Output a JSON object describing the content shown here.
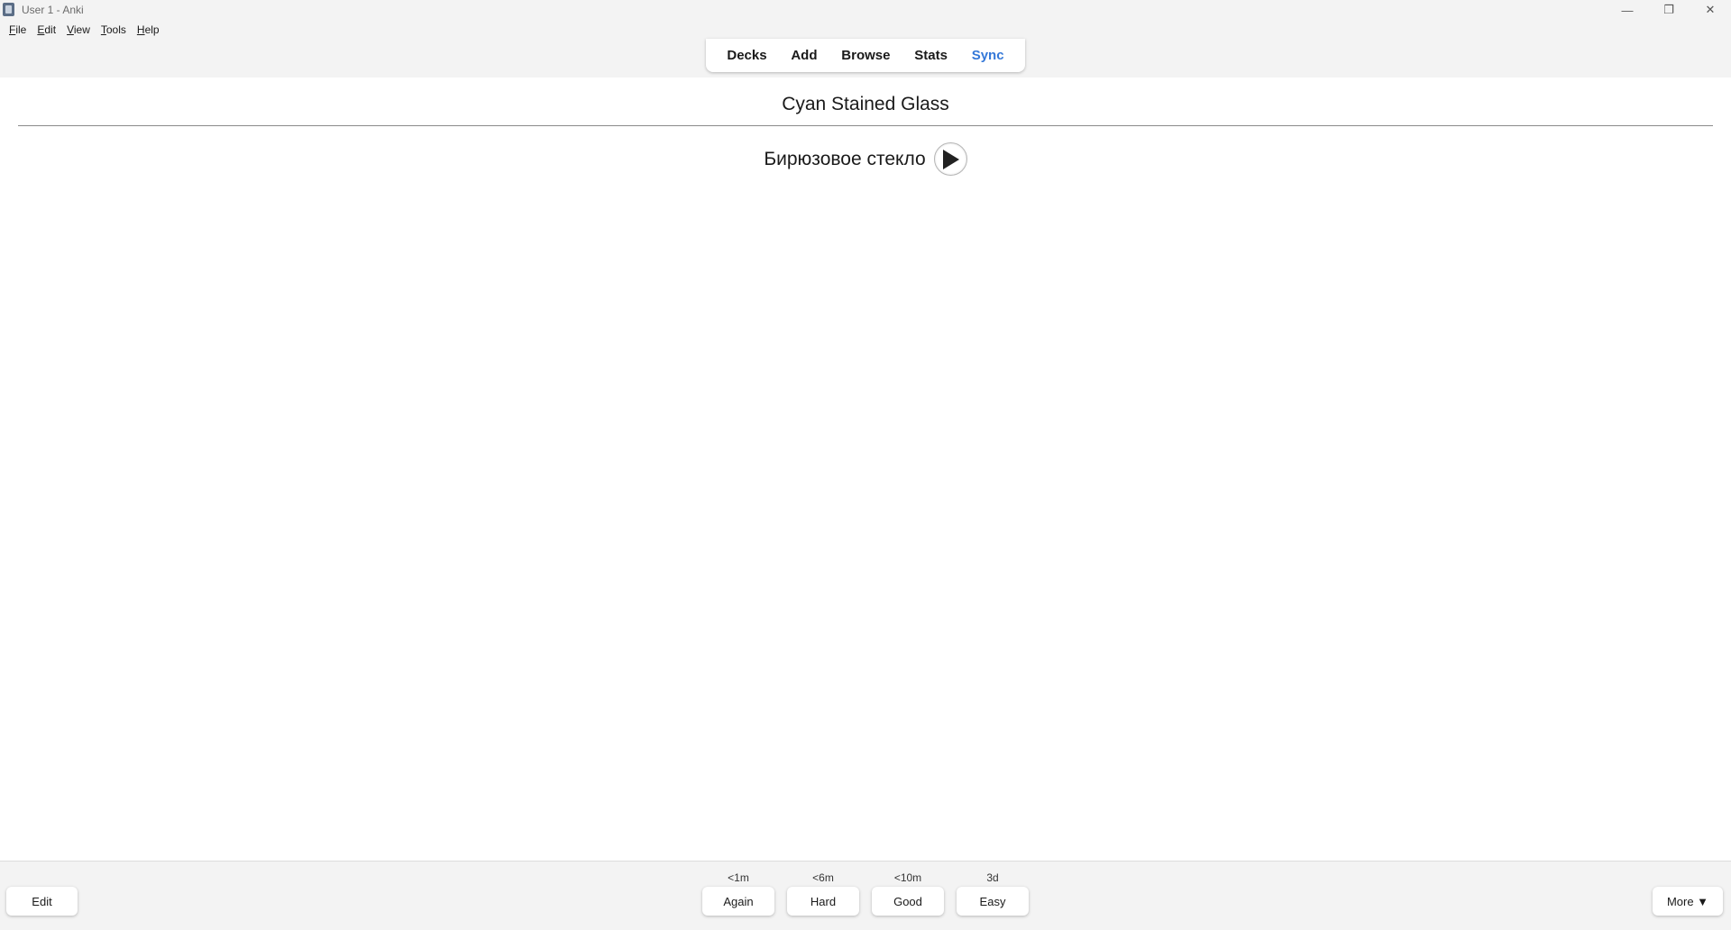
{
  "window": {
    "title": "User 1 - Anki",
    "minimize": "—",
    "maximize": "❐",
    "close": "✕"
  },
  "menu": {
    "items": [
      {
        "label": "File",
        "mnemonic": "F",
        "rest": "ile"
      },
      {
        "label": "Edit",
        "mnemonic": "E",
        "rest": "dit"
      },
      {
        "label": "View",
        "mnemonic": "V",
        "rest": "iew"
      },
      {
        "label": "Tools",
        "mnemonic": "T",
        "rest": "ools"
      },
      {
        "label": "Help",
        "mnemonic": "H",
        "rest": "elp"
      }
    ]
  },
  "toolbar": {
    "decks": "Decks",
    "add": "Add",
    "browse": "Browse",
    "stats": "Stats",
    "sync": "Sync"
  },
  "card": {
    "question": "Cyan Stained Glass",
    "answer": "Бирюзовое стекло"
  },
  "bottom": {
    "edit": "Edit",
    "more": "More ▼",
    "answers": [
      {
        "label": "Again",
        "interval": "<1m"
      },
      {
        "label": "Hard",
        "interval": "<6m"
      },
      {
        "label": "Good",
        "interval": "<10m"
      },
      {
        "label": "Easy",
        "interval": "3d"
      }
    ]
  },
  "colors": {
    "sync_accent": "#3478d8",
    "chrome_bg": "#f3f3f3"
  }
}
